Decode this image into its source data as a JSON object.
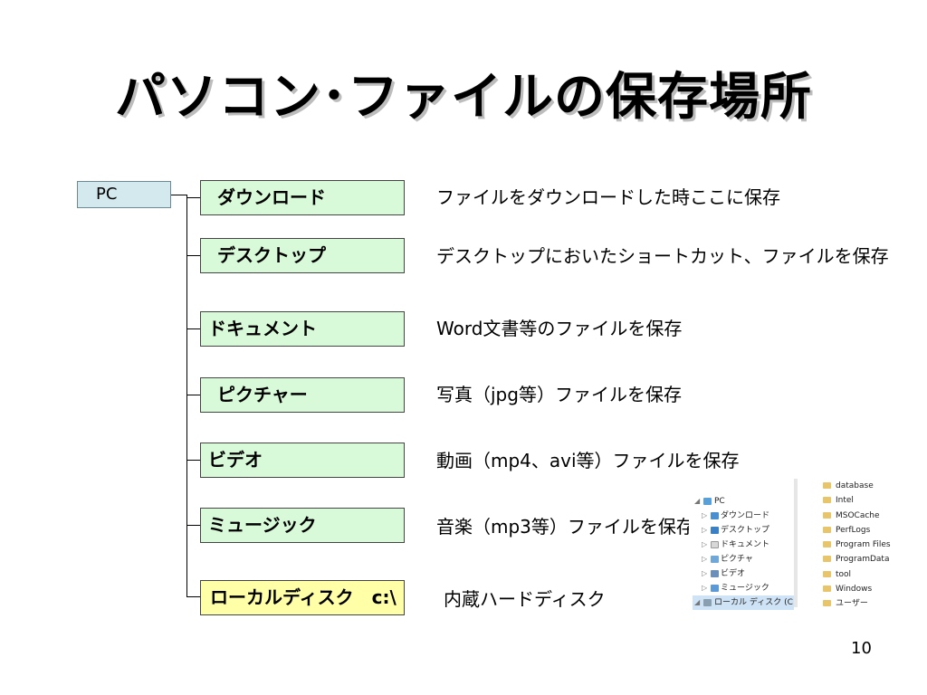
{
  "title": "パソコン･ファイルの保存場所",
  "root": "PC",
  "items": [
    {
      "label": "ダウンロード",
      "description": "ファイルをダウンロードした時ここに保存"
    },
    {
      "label": "デスクトップ",
      "description": "デスクトップにおいたショートカット、ファイルを保存"
    },
    {
      "label": "ドキュメント",
      "description": "Word文書等のファイルを保存"
    },
    {
      "label": "ピクチャー",
      "description": "写真（jpg等）ファイルを保存"
    },
    {
      "label": "ビデオ",
      "description": "動画（mp4、avi等）ファイルを保存"
    },
    {
      "label": "ミュージック",
      "description": "音楽（mp3等）ファイルを保存"
    },
    {
      "label": "ローカルディスク　c:\\",
      "description": "内蔵ハードディスク"
    }
  ],
  "explorer": {
    "tree": [
      {
        "label": "PC"
      },
      {
        "label": "ダウンロード"
      },
      {
        "label": "デスクトップ"
      },
      {
        "label": "ドキュメント"
      },
      {
        "label": "ピクチャ"
      },
      {
        "label": "ビデオ"
      },
      {
        "label": "ミュージック"
      },
      {
        "label": "ローカル ディスク (C"
      }
    ],
    "folders": [
      "database",
      "Intel",
      "MSOCache",
      "PerfLogs",
      "Program Files",
      "ProgramData",
      "tool",
      "Windows",
      "ユーザー"
    ]
  },
  "page_number": "10",
  "colors": {
    "pc_box": "#d4e9ee",
    "item_box": "#d9fad9",
    "local_disk_box": "#ffffa8",
    "folder": "#e8c56a",
    "selected_row": "#cfe3f6"
  }
}
